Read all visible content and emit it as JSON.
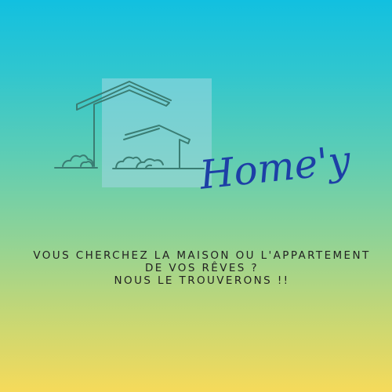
{
  "brand": {
    "logo_text": "Home'y",
    "logo_icon": "house-outline-icon",
    "logo_color": "#1d3fa6"
  },
  "tagline": {
    "line1": "VOUS CHERCHEZ LA MAISON OU L'APPARTEMENT",
    "line2": "DE VOS RÊVES ?",
    "line3": "NOUS LE TROUVERONS !!"
  },
  "colors": {
    "gradient_top": "#12c0e0",
    "gradient_bottom": "#f6da5a",
    "line_art": "#3a7d73",
    "text": "#222222"
  }
}
